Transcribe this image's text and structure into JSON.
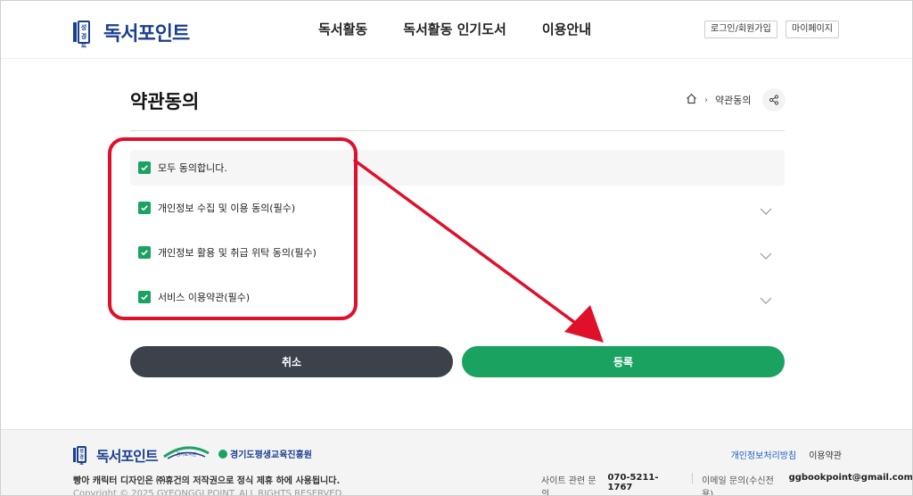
{
  "header": {
    "logo_text": "독서포인트",
    "logo_mark_text": "성경로",
    "nav": [
      "독서활동",
      "독서활동 인기도서",
      "이용안내"
    ],
    "login_label": "로그인/회원가입",
    "mypage_label": "마이페이지"
  },
  "page": {
    "title": "약관동의",
    "breadcrumb_current": "약관동의"
  },
  "agreements": {
    "all_label": "모두 동의합니다.",
    "items": [
      {
        "label": "개인정보 수집 및 이용 동의(필수)",
        "checked": true
      },
      {
        "label": "개인정보 활용 및 취급 위탁 동의(필수)",
        "checked": true
      },
      {
        "label": "서비스 이용약관(필수)",
        "checked": true
      }
    ]
  },
  "buttons": {
    "cancel": "취소",
    "submit": "등록"
  },
  "colors": {
    "accent_green": "#1aa260",
    "dark_button": "#3d424a",
    "brand_blue": "#1b3f8f",
    "annotation_red": "#e0102b"
  },
  "footer": {
    "logo_text": "독서포인트",
    "partner_text": "경기도평생교육진흥원",
    "library_text": "경기도서관",
    "privacy_link": "개인정보처리방침",
    "terms_link": "이용약관",
    "notice": "빵아 캐릭터 디자인은 ㈜휴건의 저작권으로 정식 제휴 하에 사용됩니다.",
    "copyright": "Copyright © 2025 GYEONGGI POINT. ALL RIGHTS RESERVED.",
    "site_contact_label": "사이트 관련 문의",
    "site_contact_phone": "070-5211-1767",
    "email_label": "이메일 문의(수신전용)",
    "email": "ggbookpoint@gmail.com"
  }
}
